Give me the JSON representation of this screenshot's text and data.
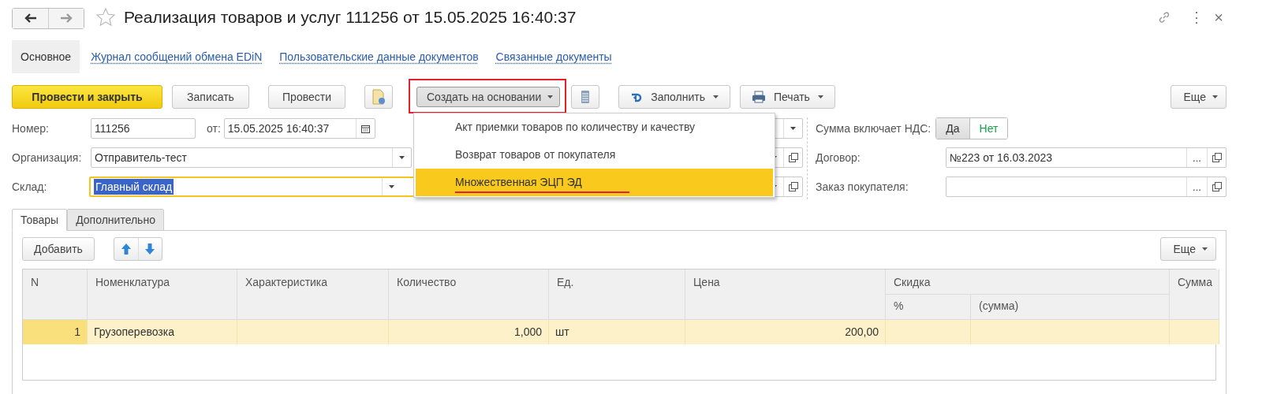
{
  "header": {
    "title": "Реализация товаров и услуг 111256 от 15.05.2025 16:40:37",
    "more": "⋮",
    "close": "×"
  },
  "sections": [
    {
      "label": "Основное",
      "selected": true
    },
    {
      "label": "Журнал сообщений обмена EDiN",
      "selected": false
    },
    {
      "label": "Пользовательские данные документов",
      "selected": false
    },
    {
      "label": "Связанные документы",
      "selected": false
    }
  ],
  "toolbar": {
    "post_close": "Провести и закрыть",
    "save": "Записать",
    "post": "Провести",
    "create_based_on": {
      "label": "Создать на основании",
      "highlighted": true,
      "expanded": true,
      "menu": [
        {
          "label": "Акт приемки товаров по количеству и качеству",
          "selected": false,
          "marked": false
        },
        {
          "label": "Возврат товаров от покупателя",
          "selected": false,
          "marked": false
        },
        {
          "label": "Множественная ЭЦП ЭД",
          "selected": true,
          "marked": true
        }
      ]
    },
    "fill": "Заполнить",
    "print": "Печать",
    "more": "Еще"
  },
  "form": {
    "number": {
      "label": "Номер:",
      "value": "111256"
    },
    "date": {
      "label": "от:",
      "value": "15.05.2025 16:40:37"
    },
    "organization": {
      "label": "Организация:",
      "value": "Отправитель-тест"
    },
    "warehouse": {
      "label": "Склад:",
      "value": "Главный склад",
      "focused": true
    },
    "vat": {
      "label": "Сумма включает НДС:",
      "options": [
        {
          "label": "Да",
          "selected": true
        },
        {
          "label": "Нет",
          "selected": false
        }
      ]
    },
    "contract": {
      "label": "Договор:",
      "value": "№223 от 16.03.2023",
      "select": "..."
    },
    "order": {
      "label": "Заказ покупателя:",
      "select": "..."
    }
  },
  "tabs": [
    {
      "label": "Товары",
      "selected": true
    },
    {
      "label": "Дополнительно",
      "selected": false
    }
  ],
  "table_toolbar": {
    "add": "Добавить",
    "more": "Еще"
  },
  "table": {
    "columns": [
      "N",
      "Номенклатура",
      "Характеристика",
      "Количество",
      "Ед.",
      "Цена",
      {
        "label": "Скидка",
        "sub": [
          "%",
          "(сумма)"
        ]
      },
      "Сумма"
    ],
    "rows": [
      {
        "selected": true,
        "cells": [
          "1",
          "Грузоперевозка",
          "",
          "1,000",
          "шт",
          "200,00",
          "",
          "",
          ""
        ]
      }
    ]
  }
}
